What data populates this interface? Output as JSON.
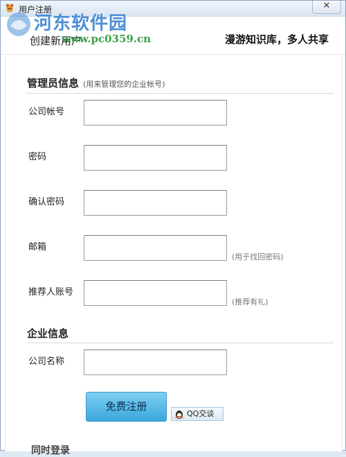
{
  "window": {
    "title": "用户注册",
    "close_label": "✕"
  },
  "watermark": {
    "site_name": "河东软件园",
    "url": "www.pc0359.cn"
  },
  "header": {
    "left_text": "创建新用户",
    "right_text": "漫游知识库，多人共享"
  },
  "admin_section": {
    "title": "管理员信息",
    "hint": "(用来管理您的企业帐号)",
    "fields": [
      {
        "label": "公司帐号",
        "value": "",
        "hint": ""
      },
      {
        "label": "密码",
        "value": "",
        "hint": ""
      },
      {
        "label": "确认密码",
        "value": "",
        "hint": ""
      },
      {
        "label": "邮箱",
        "value": "",
        "hint": "(用于找回密码)"
      },
      {
        "label": "推荐人账号",
        "value": "",
        "hint": "(推荐有礼)"
      }
    ]
  },
  "company_section": {
    "title": "企业信息",
    "fields": [
      {
        "label": "公司名称",
        "value": ""
      }
    ]
  },
  "actions": {
    "submit_label": "免费注册",
    "qq_label": "QQ交谈"
  },
  "footer_partial": "同时登录",
  "colors": {
    "accent": "#39a6dc",
    "watermark_blue": "#4c8fd6",
    "watermark_green": "#3aa14a"
  }
}
